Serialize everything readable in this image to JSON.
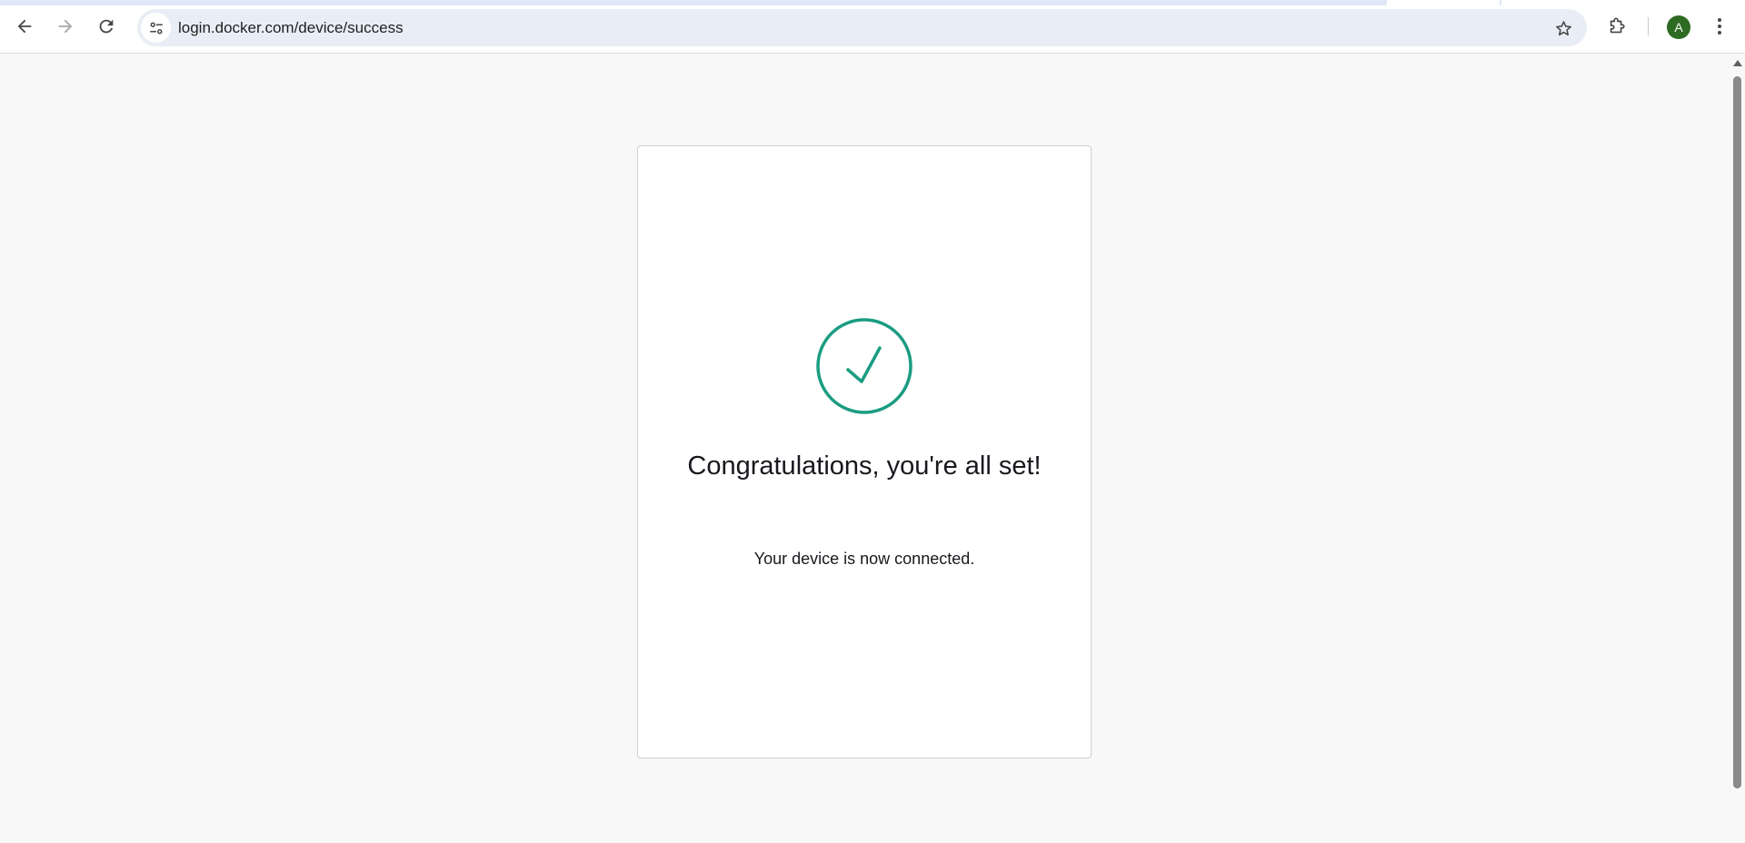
{
  "browser": {
    "url": "login.docker.com/device/success",
    "profile_initial": "A",
    "accent_color": "#2d6a22"
  },
  "page": {
    "heading": "Congratulations, you're all set!",
    "subtext": "Your device is now connected.",
    "success_color": "#1a9c82"
  },
  "icons": {
    "back": "back-arrow-icon",
    "forward": "forward-arrow-icon",
    "reload": "reload-icon",
    "site_info": "tune-icon",
    "bookmark": "star-icon",
    "extensions": "puzzle-icon",
    "menu": "kebab-menu-icon",
    "status": "check-circle-icon"
  }
}
